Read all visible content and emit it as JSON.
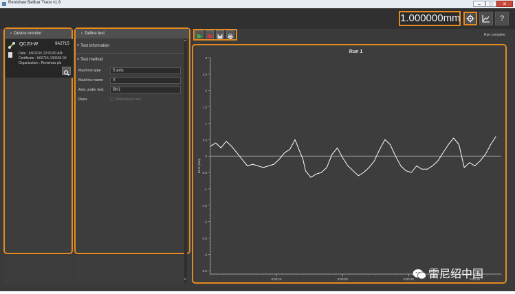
{
  "window": {
    "title": "Renishaw Ballbar Trace v1.6",
    "min": "–",
    "max": "□",
    "close": "✕"
  },
  "toolbar": {
    "scale_value": "1.000000mm",
    "settings_icon": "gear-icon",
    "chart_icon": "chart-icon",
    "help_label": "?"
  },
  "device_monitor": {
    "header": "Device monitor",
    "device_name": "QC20-W",
    "serial": "9A2715",
    "date": "Date : 5/5/2015 12:00:00 AM",
    "certificate": "Certificate : 9A2715-130505-00",
    "organization": "Organization : Renishaw plc",
    "search_icon": "search-icon"
  },
  "define_test": {
    "header": "Define test",
    "test_information": "Test information",
    "test_method": "Test method",
    "fields": [
      {
        "label": "Machine type",
        "value": "5 axis"
      },
      {
        "label": "Machine name",
        "value": "X"
      },
      {
        "label": "Axis under test",
        "value": "BK1"
      }
    ],
    "runs_label": "Runs",
    "bidirectional_label": "Bidirectional test"
  },
  "controls": {
    "play_icon": "play-icon",
    "stop_icon": "stop-icon",
    "save_icon": "save-icon",
    "print_icon": "print-icon",
    "status": "Run complete"
  },
  "watermark": "雷尼绍中国",
  "chart_data": {
    "type": "line",
    "title": "Run 1",
    "ylabel": "Error (mm)",
    "xlabel": "",
    "ylim": [
      -3.6,
      3.0
    ],
    "yticks": [
      "3",
      "2.5",
      "2",
      "1.5",
      "1",
      "0.5",
      "0",
      "-0.5",
      "-1",
      "-1.5",
      "-2",
      "-2.5",
      "-3",
      "-3.5"
    ],
    "xticks": [
      "0:00:15",
      "0:00:20",
      "0:00:25",
      "0:00:30"
    ],
    "xlim": [
      10,
      32
    ],
    "grid": false,
    "reference_line": 0,
    "series": [
      {
        "x": [
          10,
          10.4,
          10.8,
          11.2,
          11.6,
          12,
          12.4,
          12.8,
          13.2,
          13.6,
          14,
          14.4,
          14.8,
          15.2,
          15.6,
          16,
          16.4,
          16.8,
          17,
          17.2,
          17.6,
          18,
          18.4,
          18.8,
          19.2,
          19.6,
          20,
          20.4,
          20.8,
          21.2,
          21.6,
          22,
          22.4,
          22.8,
          23.2,
          23.6,
          24,
          24.4,
          24.8,
          25.2,
          25.6,
          26,
          26.4,
          26.8,
          27.2,
          27.6,
          28,
          28.4,
          28.8,
          29.2,
          29.6,
          30,
          30.4,
          30.8,
          31.2,
          31.6
        ],
        "y": [
          0.3,
          0.4,
          0.25,
          0.45,
          0.3,
          0.1,
          -0.1,
          -0.3,
          -0.25,
          -0.3,
          -0.35,
          -0.3,
          -0.25,
          -0.1,
          0.1,
          0.2,
          0.5,
          0.1,
          -0.1,
          -0.45,
          -0.65,
          -0.55,
          -0.5,
          -0.35,
          0.05,
          0.25,
          -0.05,
          -0.3,
          -0.45,
          -0.6,
          -0.5,
          -0.35,
          -0.15,
          0.2,
          0.5,
          0.35,
          0.0,
          -0.3,
          -0.45,
          -0.5,
          -0.3,
          -0.4,
          -0.4,
          -0.3,
          -0.15,
          0.1,
          0.35,
          0.55,
          0.35,
          -0.35,
          -0.2,
          -0.3,
          -0.15,
          0.05,
          0.35,
          0.6
        ]
      }
    ]
  }
}
